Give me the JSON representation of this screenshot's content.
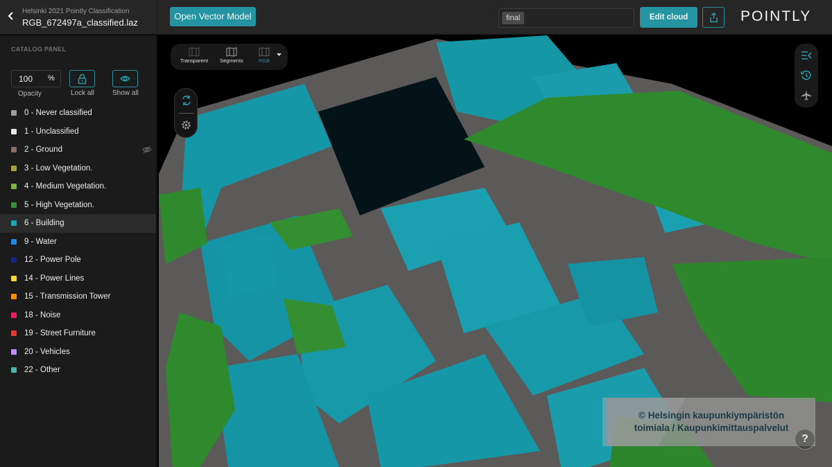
{
  "header": {
    "project_name": "Helsinki 2021 Pointly Classification",
    "file_name": "RGB_672497a_classified.laz",
    "open_vector_model_label": "Open Vector Model",
    "version_tag": "final",
    "edit_cloud_label": "Edit cloud",
    "share_icon": "share-icon",
    "logo_text": "POINTLY"
  },
  "sidebar": {
    "title": "CATALOG PANEL",
    "opacity_value": "100",
    "opacity_unit": "%",
    "opacity_label": "Opacity",
    "lock_all_label": "Lock all",
    "show_all_label": "Show all",
    "classes": [
      {
        "label": "0 - Never classified",
        "color": "#9e9e9e",
        "hidden": false,
        "active": false
      },
      {
        "label": "1 - Unclassified",
        "color": "#e6e6e6",
        "hidden": false,
        "active": false
      },
      {
        "label": "2 - Ground",
        "color": "#8d6e63",
        "hidden": true,
        "active": false
      },
      {
        "label": "3 - Low Vegetation.",
        "color": "#a3a33a",
        "hidden": false,
        "active": false
      },
      {
        "label": "4 - Medium Vegetation.",
        "color": "#7cb342",
        "hidden": false,
        "active": false
      },
      {
        "label": "5 - High Vegetation.",
        "color": "#388e3c",
        "hidden": false,
        "active": false
      },
      {
        "label": "6 - Building",
        "color": "#1aa3b5",
        "hidden": false,
        "active": true
      },
      {
        "label": "9 - Water",
        "color": "#1e88e5",
        "hidden": false,
        "active": false
      },
      {
        "label": "12 - Power Pole",
        "color": "#1a237e",
        "hidden": false,
        "active": false
      },
      {
        "label": "14 - Power Lines",
        "color": "#fdd835",
        "hidden": false,
        "active": false
      },
      {
        "label": "15 - Transmission Tower",
        "color": "#fb8c00",
        "hidden": false,
        "active": false
      },
      {
        "label": "18 - Noise",
        "color": "#e91e63",
        "hidden": false,
        "active": false
      },
      {
        "label": "19 - Street Furniture",
        "color": "#e53935",
        "hidden": false,
        "active": false
      },
      {
        "label": "20 - Vehicles",
        "color": "#c58af9",
        "hidden": false,
        "active": false
      },
      {
        "label": "22 - Other",
        "color": "#4db6ac",
        "hidden": false,
        "active": false
      }
    ]
  },
  "viewport": {
    "viz_modes": [
      {
        "label": "Transparent",
        "active": false
      },
      {
        "label": "Segments",
        "active": false
      },
      {
        "label": "RGB",
        "active": true
      }
    ],
    "copyright_line1": "© Helsingin kaupunkiympäristön",
    "copyright_line2": "toimiala / Kaupunkimittauspalvelut",
    "help_label": "?"
  },
  "colors": {
    "accent": "#2494a2",
    "building": "#1aa3b5",
    "vegetation": "#388e3c"
  }
}
